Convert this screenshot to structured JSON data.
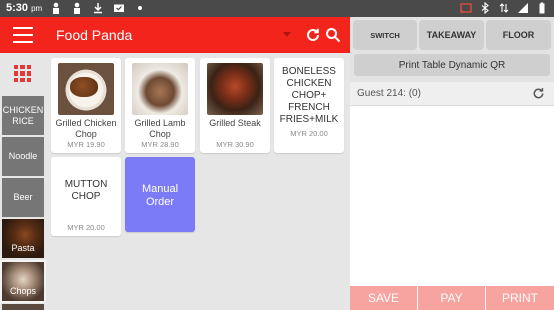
{
  "status_bar": {
    "time": "5:30",
    "ampm": "pm"
  },
  "header": {
    "title": "Food Panda"
  },
  "categories": [
    {
      "label": "CHICKEN RICE"
    },
    {
      "label": "Noodle"
    },
    {
      "label": "Beer"
    },
    {
      "label": "Pasta"
    },
    {
      "label": "Chops"
    }
  ],
  "products": [
    {
      "name": "Grilled Chicken Chop",
      "price": "MYR 19.90"
    },
    {
      "name": "Grilled Lamb Chop",
      "price": "MYR 28.90"
    },
    {
      "name": "Grilled Steak",
      "price": "MYR 30.90"
    },
    {
      "name": "BONELESS CHICKEN CHOP+ FRENCH FRIES+MILK",
      "price": "MYR 20.00"
    },
    {
      "name": "MUTTON CHOP",
      "price": "MYR 20.00"
    },
    {
      "name": "Manual Order",
      "price": ""
    }
  ],
  "right_panel": {
    "tabs": [
      {
        "label": "SWITCH"
      },
      {
        "label": "TAKEAWAY"
      },
      {
        "label": "FLOOR"
      }
    ],
    "qr_button": "Print Table Dynamic QR",
    "guest": "Guest 214: (0)",
    "actions": [
      {
        "label": "SAVE"
      },
      {
        "label": "PAY"
      },
      {
        "label": "PRINT"
      }
    ]
  },
  "colors": {
    "header_red": "#f2241c",
    "manual_order": "#7b7bf7",
    "action_pink": "#f7a3a0",
    "category_gray": "#767676"
  },
  "icons": [
    "hamburger-icon",
    "dropdown-caret-icon",
    "refresh-icon",
    "search-icon",
    "category-grid-icon"
  ]
}
